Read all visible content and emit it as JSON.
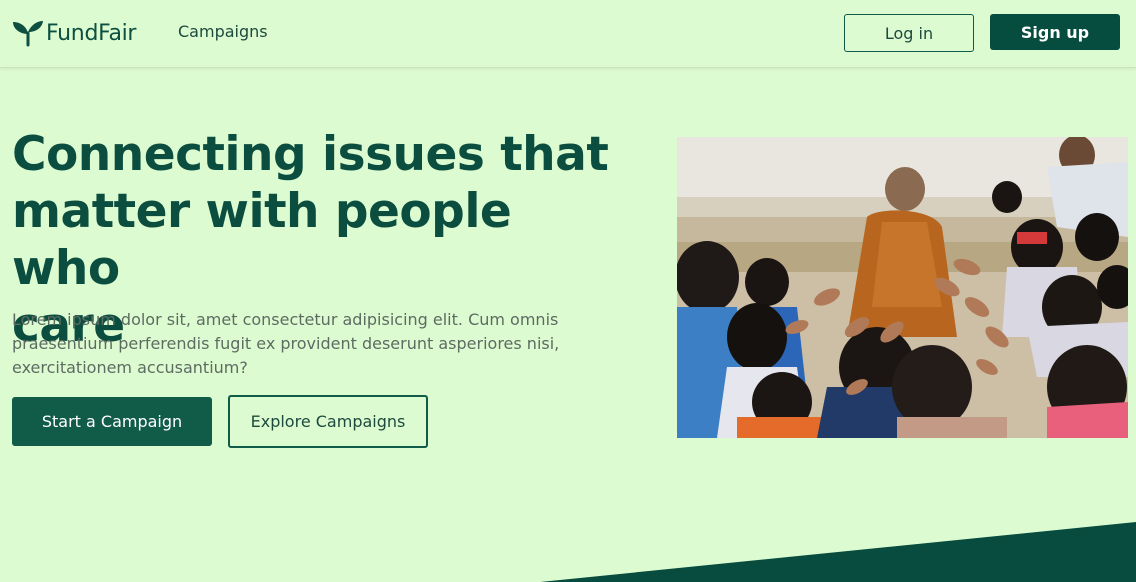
{
  "header": {
    "logo_text": "FundFair",
    "logo_icon": "sprout-icon",
    "nav": {
      "campaigns_label": "Campaigns"
    },
    "login_label": "Log in",
    "signup_label": "Sign up"
  },
  "hero": {
    "title_line1": "Connecting issues that",
    "title_line2": "matter with people who",
    "title_line3": "care",
    "description": "Lorem ipsum dolor sit, amet consectetur adipisicing elit. Cum omnis praesentium perferendis fugit ex provident deserunt asperiores nisi, exercitationem accusantium?",
    "primary_button": "Start a Campaign",
    "secondary_button": "Explore Campaigns"
  },
  "colors": {
    "background": "#ddfbd1",
    "primary": "#064c3f",
    "text_dark": "#0b4d3f",
    "text_muted": "#5d6b62"
  }
}
